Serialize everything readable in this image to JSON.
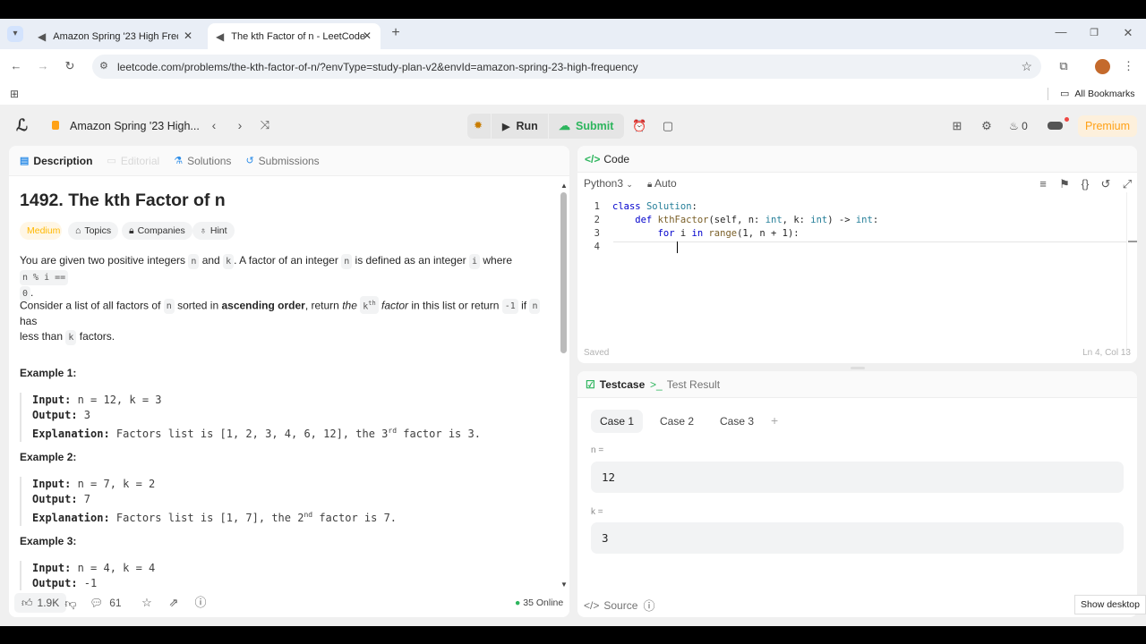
{
  "browser": {
    "tabs": [
      {
        "label": "Amazon Spring '23 High Frequ"
      },
      {
        "label": "The kth Factor of n - LeetCode"
      }
    ],
    "new_tab": "+",
    "url": "leetcode.com/problems/the-kth-factor-of-n/?envType=study-plan-v2&envId=amazon-spring-23-high-frequency",
    "bookmarks_label": "All Bookmarks"
  },
  "nav": {
    "study_plan": "Amazon Spring '23 High...",
    "run": "Run",
    "submit": "Submit",
    "fire_count": "0",
    "premium": "Premium"
  },
  "left_tabs": {
    "description": "Description",
    "editorial": "Editorial",
    "solutions": "Solutions",
    "submissions": "Submissions"
  },
  "problem": {
    "title": "1492. The kth Factor of n",
    "difficulty": "Medium",
    "topics": "Topics",
    "companies": "Companies",
    "hint": "Hint",
    "p1": {
      "t1": "You are given two positive integers ",
      "c1": "n",
      "t2": " and ",
      "c2": "k",
      "t3": ". A factor of an integer ",
      "c3": "n",
      "t4": " is defined as an integer ",
      "c4": "i",
      "t5": " where ",
      "c5": "n % i ==",
      "c6": "0",
      "t6": "."
    },
    "p2": {
      "t1": "Consider a list of all factors of ",
      "c1": "n",
      "t2": " sorted in ",
      "b1": "ascending order",
      "t3": ", return ",
      "e1": "the ",
      "c2": "k",
      "sup": "th",
      "e2": " factor",
      "t4": " in this list or return ",
      "c3": "-1",
      "t5": " if ",
      "c4": "n",
      "t6": " has",
      "t7": "less than ",
      "c5": "k",
      "t8": " factors."
    }
  },
  "examples": [
    {
      "title": "Example 1:",
      "input_label": "Input:",
      "input": " n = 12, k = 3",
      "output_label": "Output:",
      "output": " 3",
      "expl_label": "Explanation:",
      "expl_a": " Factors list is [1, 2, 3, 4, 6, 12], the 3",
      "expl_sup": "rd",
      "expl_b": " factor is 3."
    },
    {
      "title": "Example 2:",
      "input_label": "Input:",
      "input": " n = 7, k = 2",
      "output_label": "Output:",
      "output": " 7",
      "expl_label": "Explanation:",
      "expl_a": " Factors list is [1, 7], the 2",
      "expl_sup": "nd",
      "expl_b": " factor is 7."
    },
    {
      "title": "Example 3:",
      "input_label": "Input:",
      "input": " n = 4, k = 4",
      "output_label": "Output:",
      "output": " -1"
    }
  ],
  "footer_left": {
    "likes": "1.9K",
    "comments": "61",
    "online": "35 Online"
  },
  "code_panel": {
    "title": "Code",
    "language": "Python3",
    "auto": "Auto",
    "status": "Saved",
    "cursor": "Ln 4, Col 13",
    "line_numbers": [
      "1",
      "2",
      "3",
      "4"
    ],
    "lines": {
      "l1a": "class ",
      "l1b": "Solution",
      "l1c": ":",
      "l2a": "    def ",
      "l2b": "kthFactor",
      "l2c": "(self, n: ",
      "l2d": "int",
      "l2e": ", k: ",
      "l2f": "int",
      "l2g": ") -> ",
      "l2h": "int",
      "l2i": ":",
      "l3a": "        for ",
      "l3b": "i ",
      "l3c": "in ",
      "l3d": "range",
      "l3e": "(1, n + 1):"
    }
  },
  "test_panel": {
    "testcase": "Testcase",
    "test_result": "Test Result",
    "cases": [
      "Case 1",
      "Case 2",
      "Case 3"
    ],
    "add": "+",
    "params": [
      {
        "label": "n =",
        "value": "12"
      },
      {
        "label": "k =",
        "value": "3"
      }
    ],
    "source": "Source"
  },
  "taskbar": {
    "show_desktop": "Show desktop"
  },
  "colors": {
    "accent_green": "#2db55d",
    "medium": "#ffb800",
    "premium": "#ffa116"
  }
}
